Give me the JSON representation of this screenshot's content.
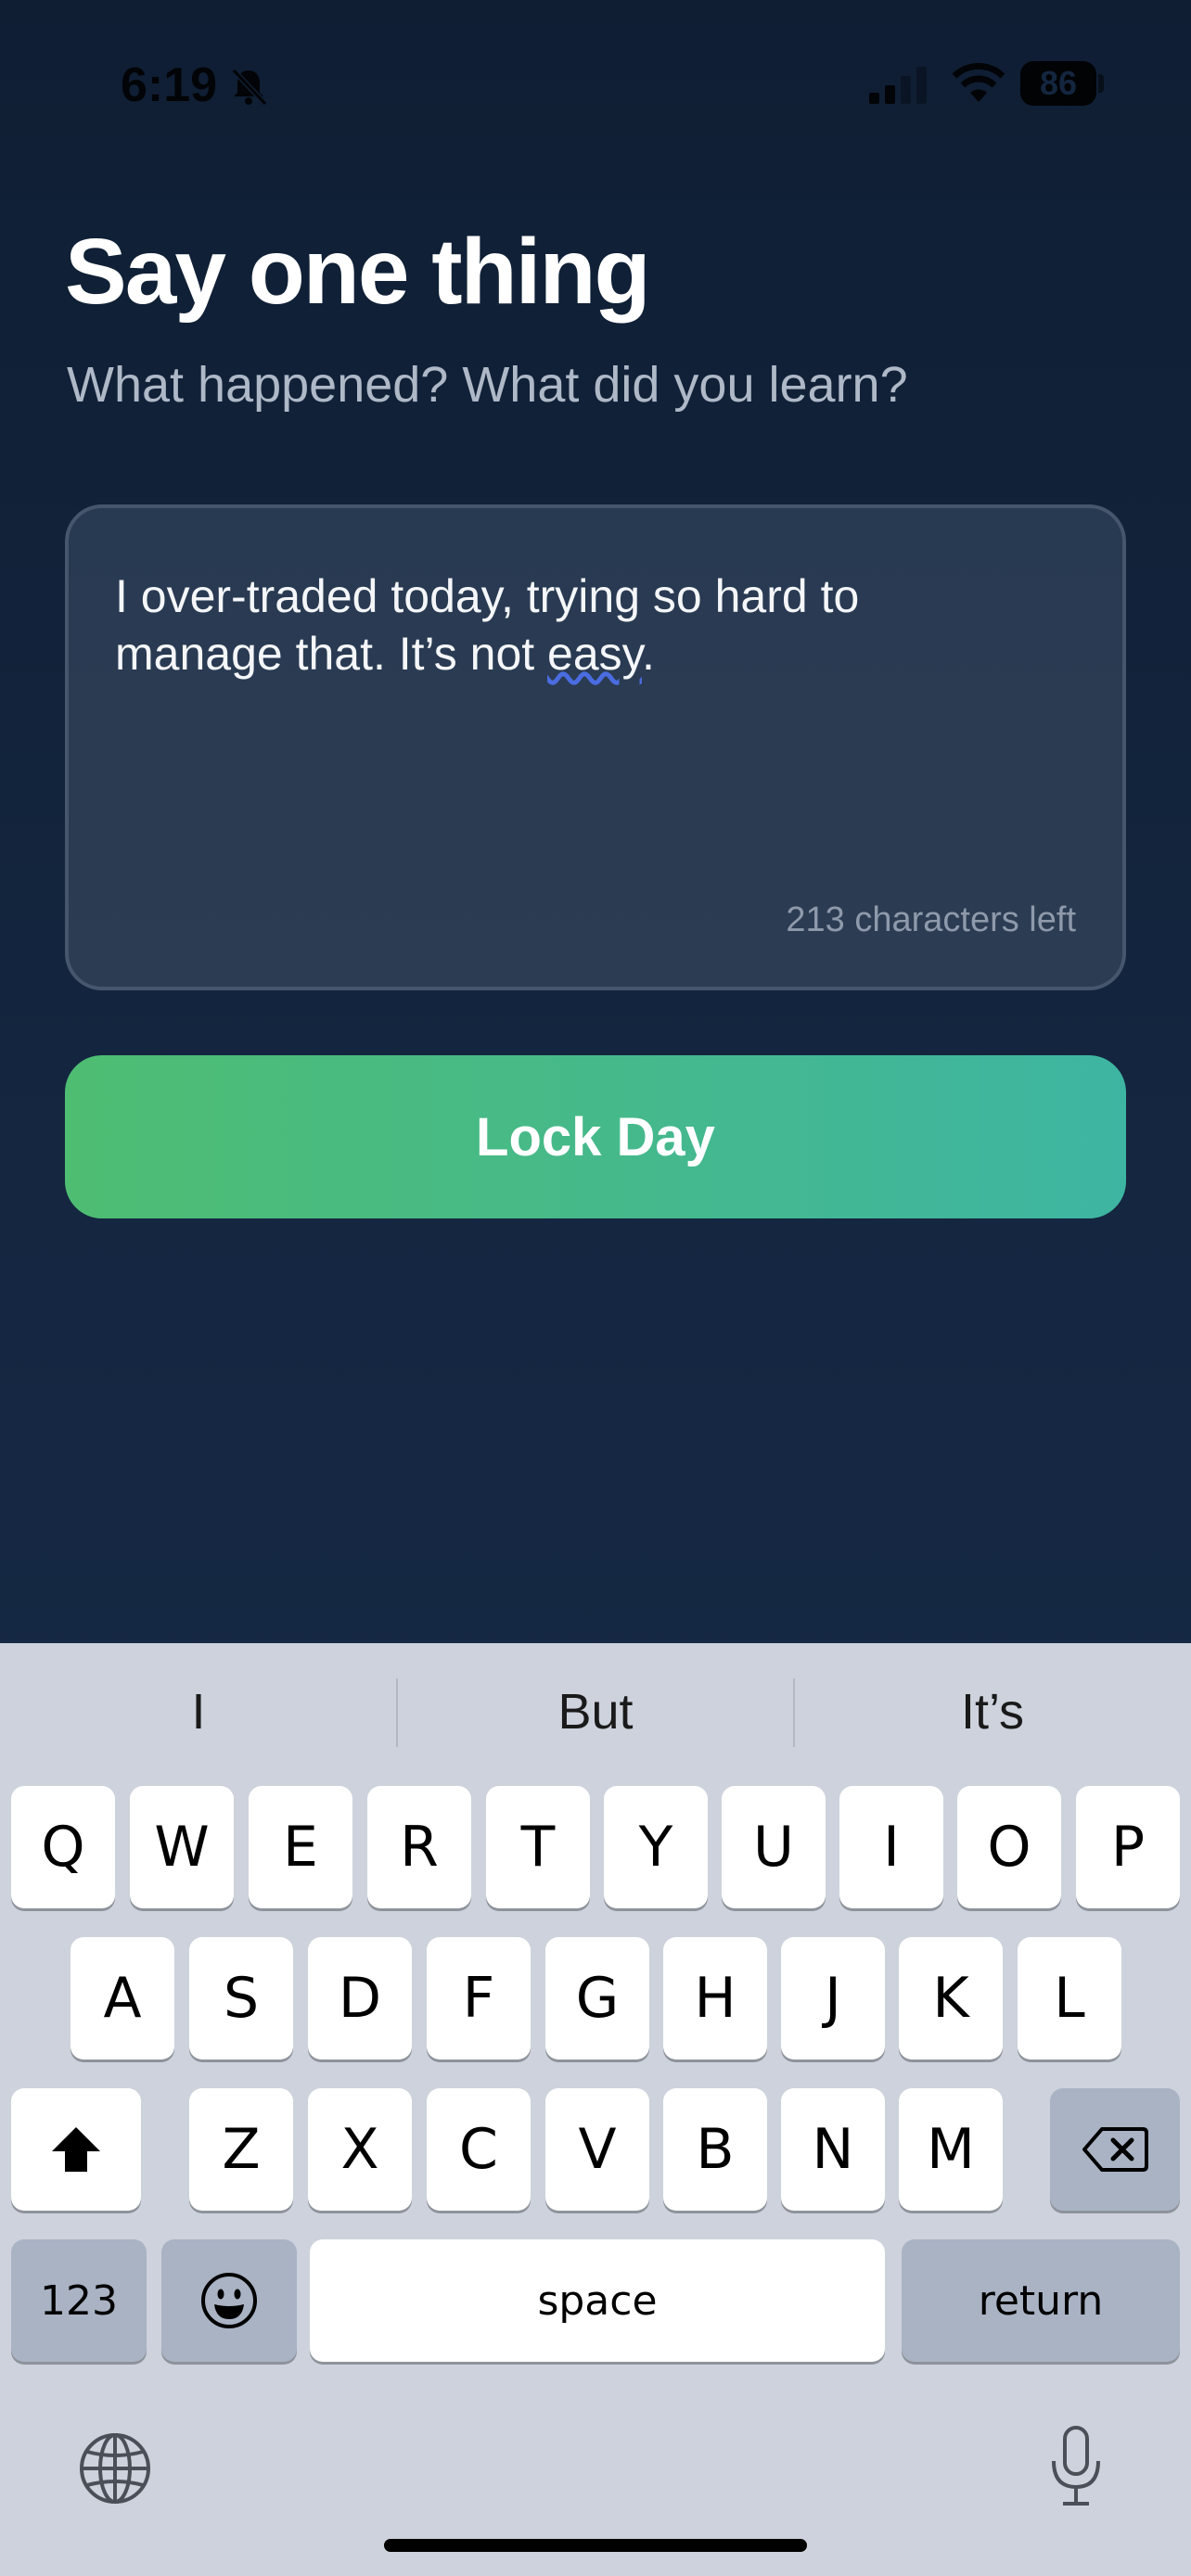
{
  "status_bar": {
    "time": "6:19",
    "battery": "86"
  },
  "header": {
    "title": "Say one thing",
    "subtitle": "What happened? What did you learn?"
  },
  "entry": {
    "text_part1": "I over-traded today, trying so hard to manage that. It’s not ",
    "text_underlined": "easy",
    "text_part2": ".",
    "characters_left": "213 characters left"
  },
  "actions": {
    "lock_label": "Lock Day"
  },
  "keyboard": {
    "suggestions": [
      "I",
      "But",
      "It’s"
    ],
    "row1": [
      "Q",
      "W",
      "E",
      "R",
      "T",
      "Y",
      "U",
      "I",
      "O",
      "P"
    ],
    "row2": [
      "A",
      "S",
      "D",
      "F",
      "G",
      "H",
      "J",
      "K",
      "L"
    ],
    "row3": [
      "Z",
      "X",
      "C",
      "V",
      "B",
      "N",
      "M"
    ],
    "numbers_label": "123",
    "space_label": "space",
    "return_label": "return"
  },
  "colors": {
    "background": "#142640",
    "accent_start": "#4ebd72",
    "accent_end": "#3eb5a2"
  }
}
